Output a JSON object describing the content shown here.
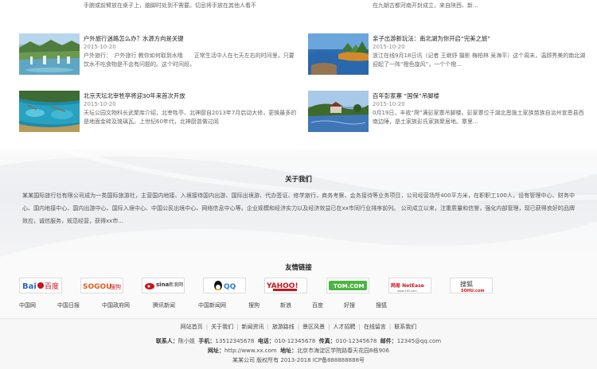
{
  "news_top": {
    "left_text": "手腕或前臂放在桌子上，脑脚时处到不需要。切忌将手放在其他人看不",
    "right_text": "在九朝古都河南开封成立，来自陕西、新..."
  },
  "news": [
    {
      "title": "户外旅行迷路怎么办？水源方向是关键",
      "date": "2015-10-20",
      "summary": "户外旅行：　户外旅行 教你如何取到水哦　　正常生活中人在七天左右的时间里，只要饮水不吃食物是不会有问题的。这个时间段，"
    },
    {
      "title": "亲子出游新玩法：南北湖为你开启“完美之旅”",
      "date": "2015-10-20",
      "summary": "浙江在线9月18日讯（记者 王继妤 摄影 梅柏林 吴海平）这个周末，温顾秀美的南北湖迎起了一阵“橙色旋风”，一个个橙..."
    },
    {
      "title": "北京天坛北宰牲亭将迎30年来首次开放",
      "date": "2015-10-20",
      "summary": "天坛公园文物科长武聚库介绍，北宰牲亭、北神厨自2013年7月启动大修，更换最多的是地面金砖及琉璃瓦。上世纪60年代，北神厨曾做过阅"
    },
    {
      "title": "百年彭家寨 “国保”吊脚楼",
      "date": "2015-10-20",
      "summary": "0月19日，丰收“爬”满彭家寨吊脚楼。彭家寨位于湖北恩施土家族苗族自治州宣恩县西南边陲，是土家族彭氏家族聚居地。寨里..."
    }
  ],
  "about": {
    "title": "关于我们",
    "body": "某某国际旅行社有限公司成为一类国际旅游社，主营国内地接、入境接待国内出游、国际出境游、代办签证、修学旅行、商务考察、会务接待等业务项目，公司经营场所400平方米，在职职工100人，设有管理中心、财务中心、国内地接中心、国内出游中心、国际入境中心、中国公民出境中心、网络信息中心等。企业规模和经济实力以及经济效益已在xx市同行业排序前列。 公司成立以来，注重质量和信誉，强化内部管理，现已获得良好的品牌效应，诚信服务，规范经营，获得xx市..."
  },
  "friends": {
    "title": "友情链接",
    "logos": [
      {
        "name": "baidu-logo",
        "text": "百度"
      },
      {
        "name": "sogou-logo",
        "text": "搜狗"
      },
      {
        "name": "sina-logo",
        "text": "新浪网"
      },
      {
        "name": "qq-logo",
        "text": "QQ"
      },
      {
        "name": "yahoo-logo",
        "text": "YAHOO!"
      },
      {
        "name": "tom-logo",
        "text": "TOM.COM"
      },
      {
        "name": "netease-logo",
        "text": "网易 NetEase"
      },
      {
        "name": "sohu-logo",
        "text": "搜狐"
      }
    ],
    "text_links": [
      "中国网",
      "中国日报",
      "中国政府网",
      "腾讯新闻",
      "中国新闻网",
      "搜狗",
      "新浪",
      "百度",
      "好搜",
      "搜狐"
    ]
  },
  "footer": {
    "nav": [
      "网站首页",
      "关于我们",
      "新闻资讯",
      "旅游路线",
      "景区风景",
      "人才招聘",
      "在线留言",
      "联系我们"
    ],
    "contact_label": "联系人：",
    "contact": "陈小姐",
    "mobile_label": "手机：",
    "mobile": "13512345678",
    "tel_label": "电话：",
    "tel": "010-12345678",
    "fax_label": "传真：",
    "fax": "010-12345678",
    "email_label": "邮件：",
    "email": "12345@qq.com",
    "site_label": "网址：",
    "site": "http://www.xx.com",
    "address_label": "地址：",
    "address": "北京市海淀区学院路春天花园8栋906",
    "copyright": "某某公司  版权所有 2013-2018 ICP备888888888号"
  },
  "colors": {
    "accent_red": "#c9151e",
    "text": "#555555",
    "heading": "#222222"
  }
}
